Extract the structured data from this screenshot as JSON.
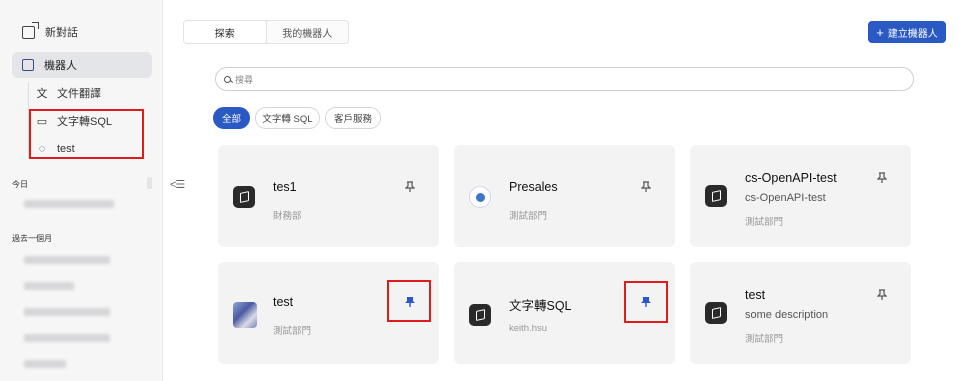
{
  "sidebar": {
    "new_chat": "新對話",
    "robots": "機器人",
    "sub_items": [
      {
        "label": "文件翻譯",
        "icon": "translate-icon"
      },
      {
        "label": "文字轉SQL",
        "icon": "monitor-icon"
      },
      {
        "label": "test",
        "icon": "headset-icon"
      }
    ],
    "section_today": "今日",
    "section_month": "過去一個月"
  },
  "tabs": [
    {
      "label": "探索",
      "active": true
    },
    {
      "label": "我的機器人",
      "active": false
    }
  ],
  "create_button": "建立機器人",
  "search_placeholder": "搜尋",
  "chips": [
    {
      "label": "全部",
      "active": true
    },
    {
      "label": "文字轉 SQL",
      "active": false
    },
    {
      "label": "客戶服務",
      "active": false
    }
  ],
  "cards": [
    {
      "title": "tes1",
      "description": "",
      "org": "財務部",
      "avatar": "cube-icon",
      "pinned": false
    },
    {
      "title": "Presales",
      "description": "",
      "org": "測試部門",
      "avatar": "logo-badge",
      "pinned": false
    },
    {
      "title": "cs-OpenAPI-test",
      "description": "cs-OpenAPI-test",
      "org": "測試部門",
      "avatar": "cube-icon",
      "pinned": false
    },
    {
      "title": "test",
      "description": "",
      "org": "測試部門",
      "avatar": "photo",
      "pinned": true
    },
    {
      "title": "文字轉SQL",
      "description": "",
      "org": "keith.hsu",
      "avatar": "cube-icon",
      "pinned": true
    },
    {
      "title": "test",
      "description": "some description",
      "org": "測試部門",
      "avatar": "cube-icon",
      "pinned": false
    }
  ],
  "colors": {
    "accent": "#2b59c3",
    "highlight": "#e01b1b",
    "card_bg": "#f3f3f4"
  }
}
